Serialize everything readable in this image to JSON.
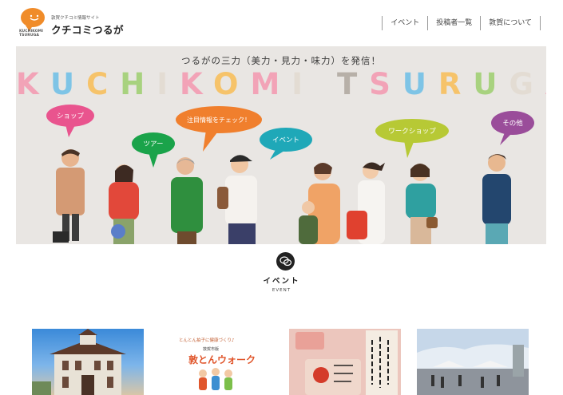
{
  "header": {
    "logo_text": "KUCHIKOMI TSURUGA",
    "site_subtitle": "敦賀クチコミ情報サイト",
    "site_title": "クチコミつるが",
    "nav": [
      {
        "label": "イベント"
      },
      {
        "label": "投稿者一覧"
      },
      {
        "label": "敦賀について"
      }
    ]
  },
  "hero": {
    "tagline": "つるがの三力（美力・見力・味力）を発信！",
    "title_letters": [
      {
        "ch": "K",
        "color": "#f2a3b7"
      },
      {
        "ch": "U",
        "color": "#7ec4e6"
      },
      {
        "ch": "C",
        "color": "#f6c36a"
      },
      {
        "ch": "H",
        "color": "#a8d27f"
      },
      {
        "ch": "I",
        "color": "#e3dcd3"
      },
      {
        "ch": "K",
        "color": "#f2a3b7"
      },
      {
        "ch": "O",
        "color": "#f6c36a"
      },
      {
        "ch": "M",
        "color": "#f2a3b7"
      },
      {
        "ch": "I",
        "color": "#e3dcd3"
      },
      {
        "ch": " ",
        "color": "#e9e6e3"
      },
      {
        "ch": "T",
        "color": "#b7b0a8"
      },
      {
        "ch": "S",
        "color": "#f2a3b7"
      },
      {
        "ch": "U",
        "color": "#7ec4e6"
      },
      {
        "ch": "R",
        "color": "#f6c36a"
      },
      {
        "ch": "U",
        "color": "#a8d27f"
      },
      {
        "ch": "G",
        "color": "#e3dcd3"
      },
      {
        "ch": "A",
        "color": "#f2a3b7"
      }
    ],
    "bubbles": {
      "shop": "ショップ",
      "tour": "ツアー",
      "notice": "注目情報をチェック！",
      "event": "イベント",
      "workshop": "ワークショップ",
      "other": "その他"
    },
    "bubble_colors": {
      "shop": "#e9548e",
      "tour": "#1aa34a",
      "notice": "#f07f2d",
      "event": "#1fa8b8",
      "workshop": "#b7c935",
      "other": "#9a4d9a"
    }
  },
  "section": {
    "icon": "chat-bubbles-icon",
    "title": "イベント",
    "subtitle": "EVENT"
  },
  "cards": [
    {
      "name": "card-western-building",
      "image": "western-building-photo"
    },
    {
      "name": "card-walk-event",
      "line1": "とんとん拍子に健康づくり♪",
      "line2": "敦賀市版",
      "line3": "敦とんウォーク"
    },
    {
      "name": "card-handwriting",
      "image": "handwriting-cards-photo"
    },
    {
      "name": "card-outdoor-event",
      "image": "outdoor-event-photo"
    }
  ]
}
